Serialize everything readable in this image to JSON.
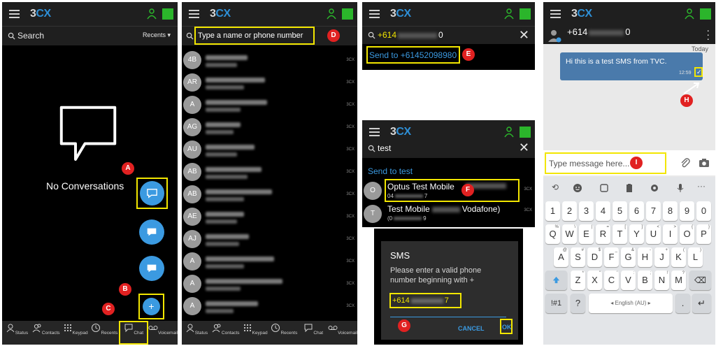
{
  "common": {
    "logo_main": "3",
    "logo_accent": "CX"
  },
  "panel1": {
    "search_label": "Search",
    "recents_label": "Recents",
    "empty_text": "No Conversations",
    "fab_sms_label": "sms",
    "fab_add_label": "+",
    "marker_a": "A",
    "marker_b": "B",
    "marker_c": "C",
    "nav": [
      {
        "label": "Status",
        "icon": "status-icon"
      },
      {
        "label": "Contacts",
        "icon": "contacts-icon"
      },
      {
        "label": "Keypad",
        "icon": "keypad-icon"
      },
      {
        "label": "Recents",
        "icon": "recents-icon"
      },
      {
        "label": "Chat",
        "icon": "chat-icon"
      },
      {
        "label": "Voicemail",
        "icon": "voicemail-icon"
      }
    ]
  },
  "panel2": {
    "search_placeholder": "Type a name or phone number",
    "marker_d": "D",
    "contacts": [
      {
        "initials": "4B",
        "tag": "3CX"
      },
      {
        "initials": "AR",
        "tag": "3CX"
      },
      {
        "initials": "A",
        "tag": "3CX"
      },
      {
        "initials": "AG",
        "tag": "3CX"
      },
      {
        "initials": "AU",
        "tag": "3CX"
      },
      {
        "initials": "AB",
        "tag": "3CX"
      },
      {
        "initials": "AB",
        "tag": "3CX"
      },
      {
        "initials": "AE",
        "tag": "3CX"
      },
      {
        "initials": "AJ",
        "tag": "3CX"
      },
      {
        "initials": "A",
        "tag": "3CX"
      },
      {
        "initials": "A",
        "tag": "3CX"
      },
      {
        "initials": "A",
        "tag": "3CX"
      }
    ],
    "nav": [
      {
        "label": "Status"
      },
      {
        "label": "Contacts"
      },
      {
        "label": "Keypad"
      },
      {
        "label": "Recents"
      },
      {
        "label": "Chat"
      },
      {
        "label": "Voicemail"
      }
    ]
  },
  "panel3": {
    "search_value_prefix": "+614",
    "search_value_suffix": "0",
    "send_to": "Send to +61452098980",
    "marker_e": "E"
  },
  "panel4": {
    "search_value": "test",
    "send_to": "Send to test",
    "results": [
      {
        "initial": "O",
        "name": "Optus Test Mobile",
        "number_prefix": "04",
        "number_suffix": "7",
        "tag": "3CX"
      },
      {
        "initial": "T",
        "name": "Test Mobile",
        "name_suffix": "Vodafone)",
        "number_prefix": "(0",
        "number_suffix": "9",
        "tag": "3CX"
      }
    ],
    "marker_f": "F"
  },
  "panel5": {
    "title": "SMS",
    "message": "Please enter a valid phone number beginning with +",
    "input_prefix": "+614",
    "input_suffix": "7",
    "cancel_label": "CANCEL",
    "ok_label": "OK",
    "marker_g": "G"
  },
  "panel6": {
    "header_prefix": "+614",
    "header_suffix": "0",
    "day_label": "Today",
    "message_text": "Hi this is a test SMS from TVC.",
    "message_time": "12:59",
    "input_placeholder": "Type message here...",
    "marker_h": "H",
    "marker_i": "I",
    "keyboard": {
      "numbers": [
        "1",
        "2",
        "3",
        "4",
        "5",
        "6",
        "7",
        "8",
        "9",
        "0"
      ],
      "row1": [
        {
          "k": "Q",
          "s": "%"
        },
        {
          "k": "W",
          "s": "\\"
        },
        {
          "k": "E",
          "s": "|"
        },
        {
          "k": "R",
          "s": "="
        },
        {
          "k": "T",
          "s": "["
        },
        {
          "k": "Y",
          "s": "]"
        },
        {
          "k": "U",
          "s": "<"
        },
        {
          "k": "I",
          "s": ">"
        },
        {
          "k": "O",
          "s": "{"
        },
        {
          "k": "P",
          "s": "}"
        }
      ],
      "row2": [
        {
          "k": "A",
          "s": "@"
        },
        {
          "k": "S",
          "s": "#"
        },
        {
          "k": "D",
          "s": "$"
        },
        {
          "k": "F",
          "s": "_"
        },
        {
          "k": "G",
          "s": "&"
        },
        {
          "k": "H",
          "s": "-"
        },
        {
          "k": "J",
          "s": "+"
        },
        {
          "k": "K",
          "s": "("
        },
        {
          "k": "L",
          "s": ")"
        }
      ],
      "row3": [
        {
          "k": "Z",
          "s": "*"
        },
        {
          "k": "X",
          "s": "\""
        },
        {
          "k": "C",
          "s": "'"
        },
        {
          "k": "V",
          "s": ":"
        },
        {
          "k": "B",
          "s": ";"
        },
        {
          "k": "N",
          "s": "!"
        },
        {
          "k": "M",
          "s": "?"
        }
      ],
      "symbols_label": "!#1",
      "comma_label": "?",
      "space_label": "English (AU)",
      "period_label": "."
    }
  }
}
